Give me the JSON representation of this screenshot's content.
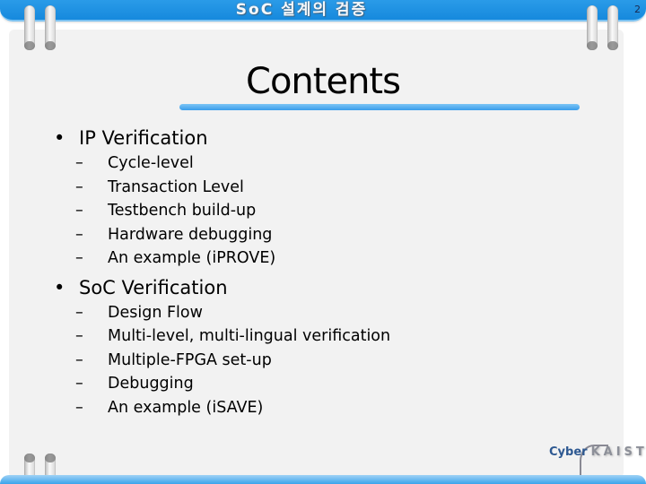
{
  "header": {
    "title": "SoC 설계의 검증",
    "page_number": "2"
  },
  "slide": {
    "title": "Contents",
    "sections": [
      {
        "label": "IP Verification",
        "bullet": "•",
        "items": [
          "Cycle-level",
          "Transaction Level",
          "Testbench build-up",
          "Hardware debugging",
          "An example (iPROVE)"
        ]
      },
      {
        "label": "SoC Verification",
        "bullet": "•",
        "items": [
          "Design Flow",
          "Multi-level, multi-lingual verification",
          "Multiple-FPGA set-up",
          "Debugging",
          "An example (iSAVE)"
        ]
      }
    ],
    "dash": "–"
  },
  "footer": {
    "logo_left": "Cyber",
    "logo_right": "KAIST"
  },
  "colors": {
    "accent": "#1c8fe0",
    "panel": "#f2f2f2"
  }
}
